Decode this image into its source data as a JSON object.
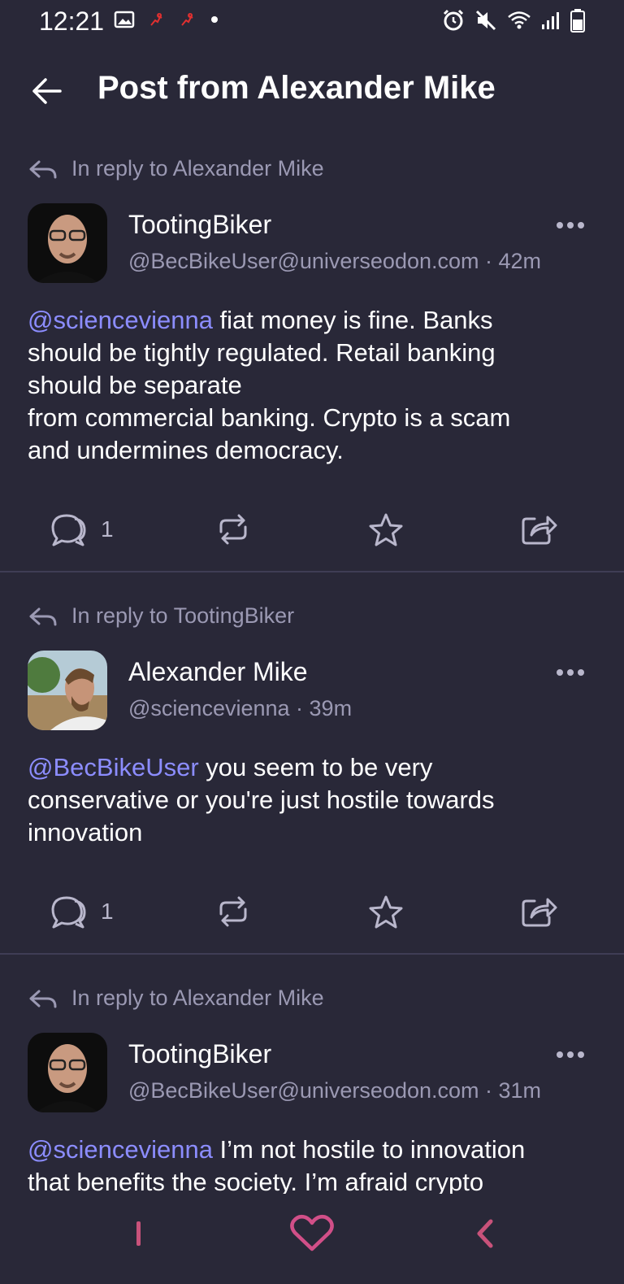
{
  "status_bar": {
    "time": "12:21",
    "left_icons": [
      "gallery-icon",
      "runner-icon",
      "runner-icon",
      "dot-icon"
    ],
    "right_icons": [
      "alarm-icon",
      "mute-icon",
      "wifi-icon",
      "signal-icon",
      "battery-icon"
    ]
  },
  "header": {
    "title": "Post from Alexander Mike",
    "back_icon": "arrow-left-icon"
  },
  "posts": [
    {
      "reply_to": "In reply to Alexander Mike",
      "name": "TootingBiker",
      "handle": "@BecBikeUser@universeodon.com",
      "time": "42m",
      "mention": "@sciencevienna",
      "lines": [
        " fiat money is fine. Banks",
        "should be tightly regulated. Retail banking",
        "should be separate",
        "from commercial banking. Crypto is a scam",
        "and undermines democracy."
      ],
      "reply_count": "1"
    },
    {
      "reply_to": "In reply to TootingBiker",
      "name": "Alexander Mike",
      "handle": "@sciencevienna",
      "time": "39m",
      "mention": "@BecBikeUser",
      "lines": [
        " you seem to be very",
        "conservative or you're just hostile towards",
        "innovation"
      ],
      "reply_count": "1"
    },
    {
      "reply_to": "In reply to Alexander Mike",
      "name": "TootingBiker",
      "handle": "@BecBikeUser@universeodon.com",
      "time": "31m",
      "mention": "@sciencevienna",
      "lines": [
        " I’m not hostile to innovation",
        "that benefits the society. I’m afraid crypto"
      ]
    }
  ],
  "handle_sep": " · ",
  "colors": {
    "background": "#292838",
    "accent_mention": "#8c8dff",
    "muted_text": "#9b99b3",
    "nav_accent": "#c8527a"
  },
  "nav_bar": [
    "recents-icon",
    "home-heart-icon",
    "back-chevron-icon"
  ]
}
